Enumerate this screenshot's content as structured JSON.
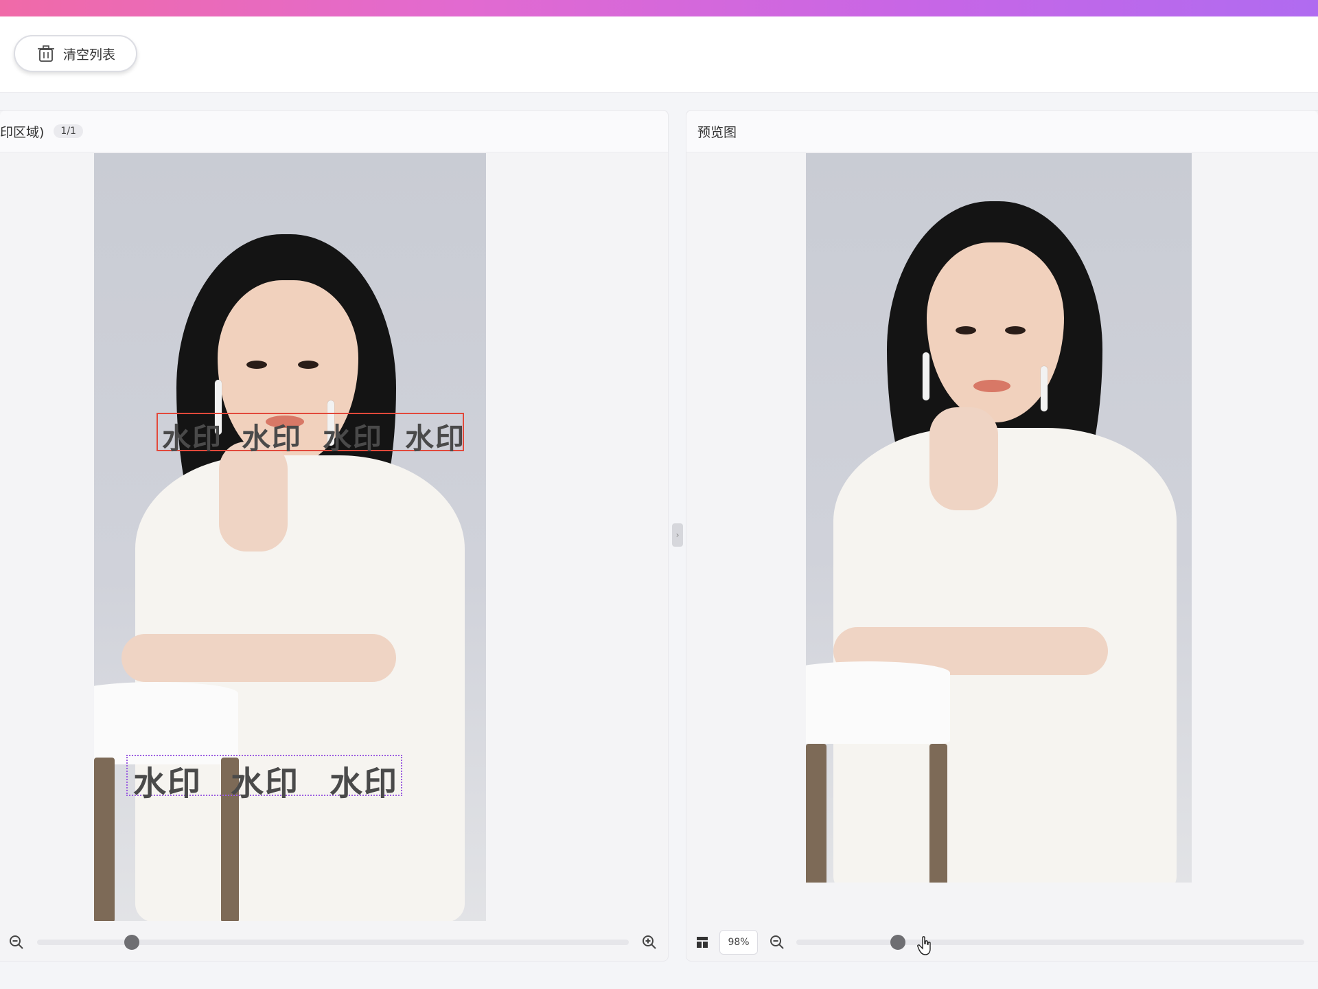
{
  "toolbar": {
    "clear_label": "清空列表",
    "clear_icon": "trash-icon"
  },
  "left_panel": {
    "title": "印区域)",
    "count": "1/1",
    "watermark_top": [
      "水印",
      "水印",
      "水印",
      "水印"
    ],
    "watermark_bottom": [
      "水印",
      "水印",
      "水印"
    ],
    "zoom_level": 0.16
  },
  "right_panel": {
    "title": "预览图",
    "zoom_value": "98%",
    "zoom_level": 0.2
  },
  "colors": {
    "accent_gradient_start": "#f06aa8",
    "accent_gradient_end": "#b06bf0",
    "selection_red": "#e2493b",
    "selection_purple": "#9b5ee0"
  },
  "icons": {
    "zoom_out": "zoom-out-icon",
    "zoom_in": "zoom-in-icon",
    "layout": "layout-icon",
    "collapse": "chevron-right-icon",
    "cursor": "hand-cursor-icon"
  }
}
